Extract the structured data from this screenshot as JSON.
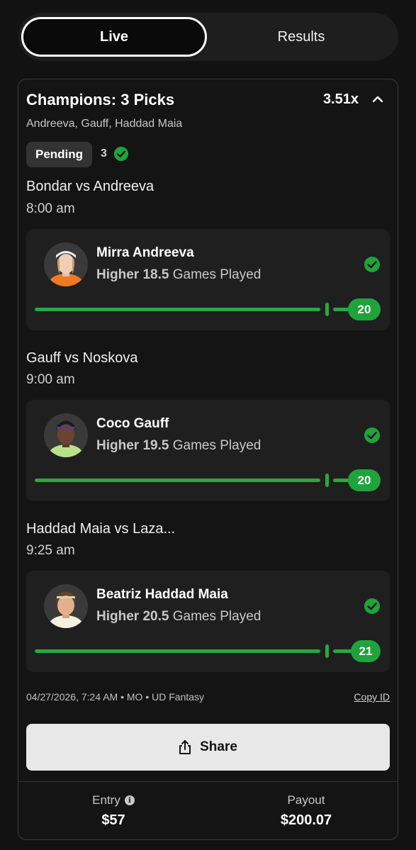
{
  "tabs": {
    "live": "Live",
    "results": "Results"
  },
  "entry_card": {
    "title": "Champions: 3 Picks",
    "multiplier": "3.51x",
    "players_summary": "Andreeva, Gauff, Haddad Maia",
    "status": "Pending",
    "correct_count": "3"
  },
  "picks": [
    {
      "match": "Bondar vs Andreeva",
      "time": "8:00 am",
      "player": "Mirra Andreeva",
      "direction": "Higher",
      "line": "18.5",
      "stat": "Games Played",
      "result": "20",
      "avatar_shirt_color": "#f07a22"
    },
    {
      "match": "Gauff vs Noskova",
      "time": "9:00 am",
      "player": "Coco Gauff",
      "direction": "Higher",
      "line": "19.5",
      "stat": "Games Played",
      "result": "20",
      "avatar_shirt_color": "#b8e28a"
    },
    {
      "match": "Haddad Maia vs Laza...",
      "time": "9:25 am",
      "player": "Beatriz Haddad Maia",
      "direction": "Higher",
      "line": "20.5",
      "stat": "Games Played",
      "result": "21",
      "avatar_shirt_color": "#f4f0e0"
    }
  ],
  "meta": {
    "info": "04/27/2026, 7:24 AM • MO • UD Fantasy",
    "copy_id": "Copy ID"
  },
  "share_label": "Share",
  "footer": {
    "entry_label": "Entry",
    "entry_value": "$57",
    "payout_label": "Payout",
    "payout_value": "$200.07"
  },
  "colors": {
    "accent_green": "#1fa33b",
    "background": "#121212",
    "card": "#1f1f1f"
  }
}
